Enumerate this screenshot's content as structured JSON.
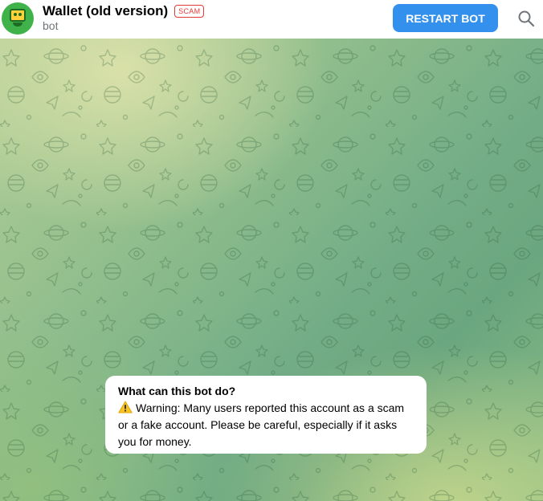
{
  "header": {
    "avatar_icon": "wallet-bot-avatar-icon",
    "title": "Wallet (old version)",
    "scam_badge": "SCAM",
    "subtitle": "bot",
    "restart_label": "RESTART BOT",
    "search_icon": "search-icon"
  },
  "info_bubble": {
    "title": "What can this bot do?",
    "warning_icon": "warning-icon",
    "text": "Warning: Many users reported this account as a scam or a fake account. Please be careful, especially if it asks you for money."
  },
  "colors": {
    "accent": "#3390ec",
    "scam": "#e53935",
    "subtitle": "#707579",
    "avatar": "#3fb34a"
  }
}
